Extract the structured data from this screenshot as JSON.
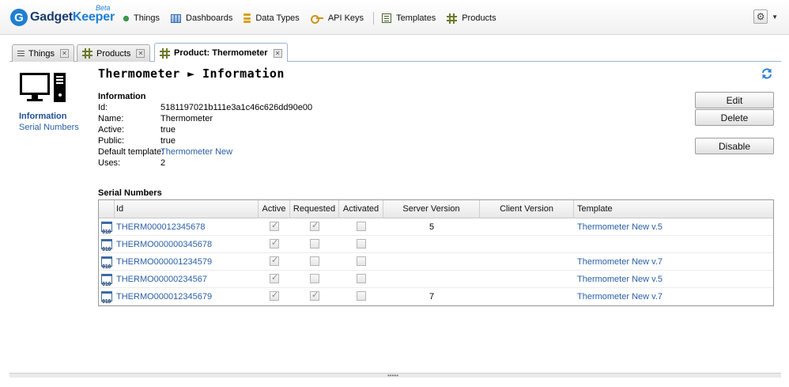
{
  "app": {
    "logo_letter": "G",
    "logo_name_part1": "Gadget",
    "logo_name_part2": "Keeper",
    "beta": "Beta"
  },
  "nav": [
    {
      "label": "Things",
      "icon": "green-dot-icon"
    },
    {
      "label": "Dashboards",
      "icon": "dashboard-icon"
    },
    {
      "label": "Data Types",
      "icon": "data-types-icon"
    },
    {
      "label": "API Keys",
      "icon": "key-icon"
    },
    {
      "label": "Templates",
      "icon": "templates-icon"
    },
    {
      "label": "Products",
      "icon": "grid-icon"
    }
  ],
  "settings": {
    "icon": "gear-icon",
    "caret": "▼"
  },
  "tabs": [
    {
      "label": "Things",
      "icon": "list-icon",
      "active": false
    },
    {
      "label": "Products",
      "icon": "grid-icon",
      "active": false
    },
    {
      "label": "Product: Thermometer",
      "icon": "grid-icon",
      "active": true
    }
  ],
  "tab_close_glyph": "✕",
  "sidebar": {
    "items": [
      {
        "label": "Information",
        "selected": true
      },
      {
        "label": "Serial Numbers",
        "selected": false
      }
    ]
  },
  "heading": "Thermometer ► Information",
  "information": {
    "title": "Information",
    "fields": [
      {
        "label": "Id:",
        "value": "5181197021b111e3a1c46c626dd90e00"
      },
      {
        "label": "Name:",
        "value": "Thermometer"
      },
      {
        "label": "Active:",
        "value": "true"
      },
      {
        "label": "Public:",
        "value": "true"
      },
      {
        "label": "Default template:",
        "value": "Thermometer New",
        "link": true
      },
      {
        "label": "Uses:",
        "value": "2"
      }
    ]
  },
  "buttons": {
    "edit": "Edit",
    "delete": "Delete",
    "disable": "Disable"
  },
  "serial_numbers": {
    "title": "Serial Numbers",
    "columns": [
      "Id",
      "Active",
      "Requested",
      "Activated",
      "Server Version",
      "Client Version",
      "Template"
    ],
    "rows": [
      {
        "id": "THERM000012345678",
        "active": true,
        "requested": true,
        "activated": false,
        "server_version": "5",
        "client_version": "",
        "template": "Thermometer New v.5"
      },
      {
        "id": "THERMO000000345678",
        "active": true,
        "requested": false,
        "activated": false,
        "server_version": "",
        "client_version": "",
        "template": ""
      },
      {
        "id": "THERMO000001234579",
        "active": true,
        "requested": false,
        "activated": false,
        "server_version": "",
        "client_version": "",
        "template": "Thermometer New v.7"
      },
      {
        "id": "THERMO00000234567",
        "active": true,
        "requested": false,
        "activated": false,
        "server_version": "",
        "client_version": "",
        "template": "Thermometer New v.5"
      },
      {
        "id": "THERMO000012345679",
        "active": true,
        "requested": true,
        "activated": false,
        "server_version": "7",
        "client_version": "",
        "template": "Thermometer New v.7"
      }
    ]
  },
  "splitter_grip": "•••••",
  "colors": {
    "link": "#2a5fa5",
    "brand_blue": "#1e7fd1",
    "brand_dark": "#1a3b6b",
    "things_green": "#3aa14a"
  }
}
